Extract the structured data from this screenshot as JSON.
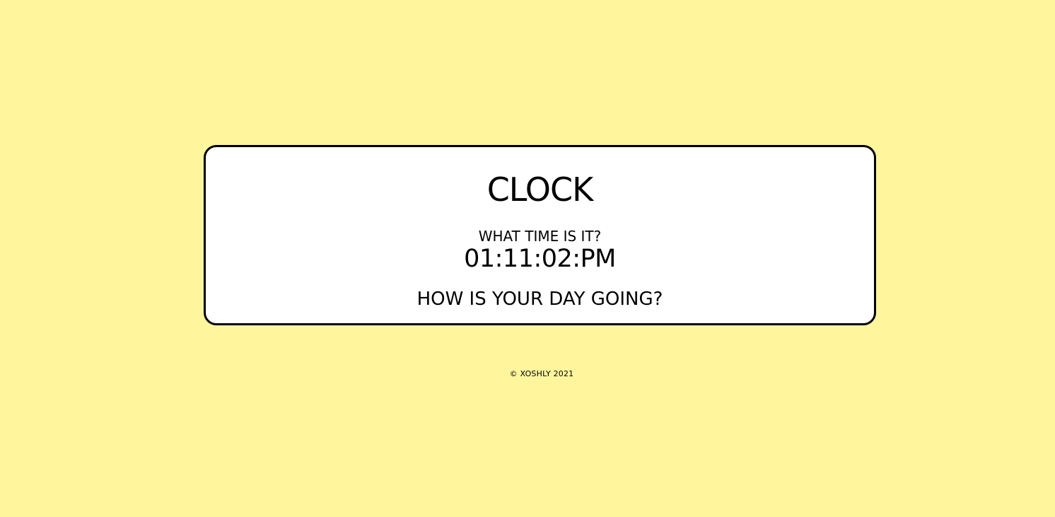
{
  "card": {
    "title": "CLOCK",
    "question": "WHAT TIME IS IT?",
    "time": "01:11:02:PM",
    "day_question": "HOW IS YOUR DAY GOING?"
  },
  "footer": {
    "copyright": "© XOSHLY 2021"
  },
  "colors": {
    "background": "#fff59d",
    "card_background": "#ffffff",
    "text": "#000000",
    "border": "#000000"
  }
}
